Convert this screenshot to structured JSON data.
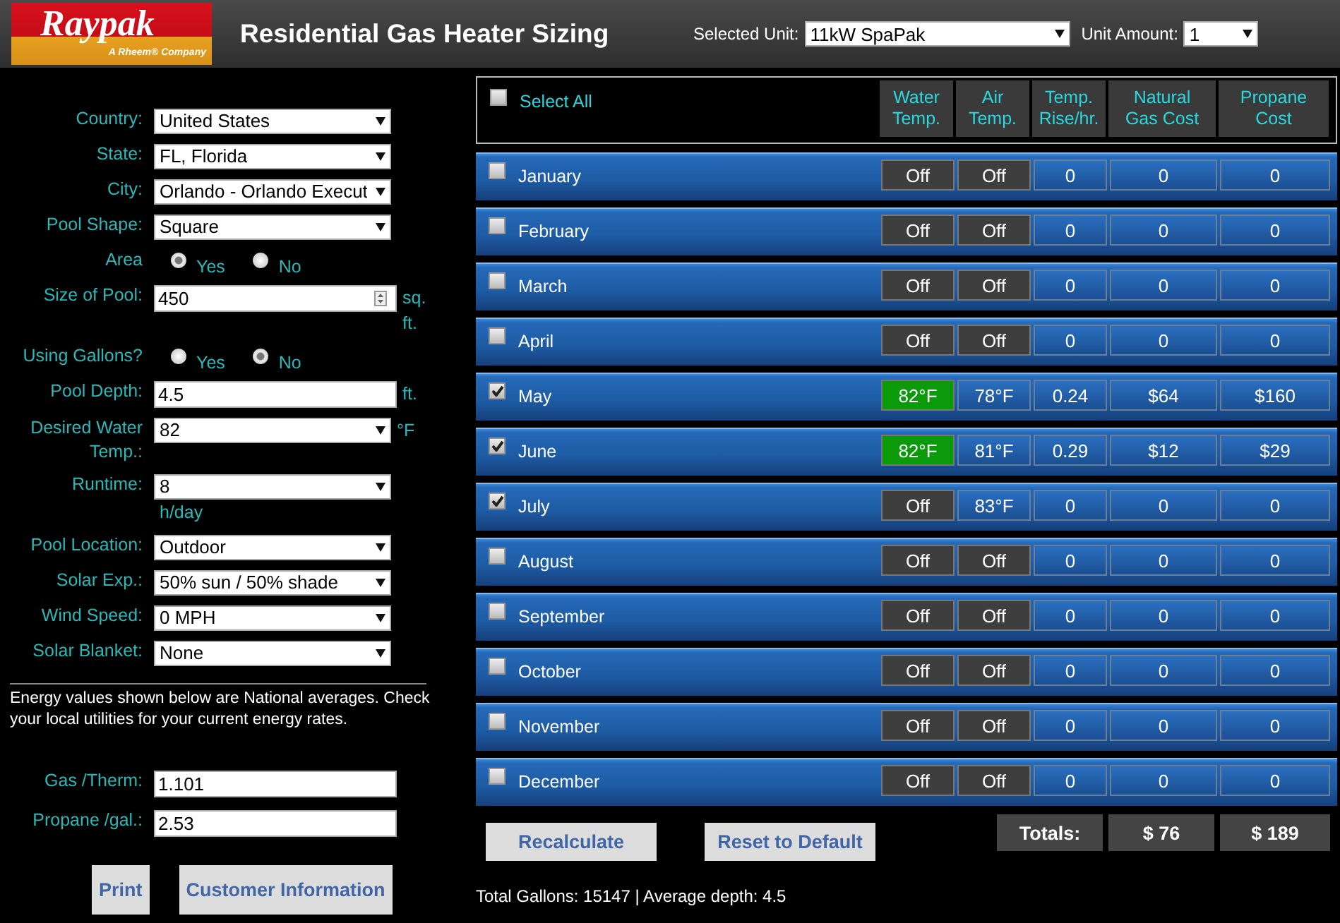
{
  "header": {
    "logo": {
      "wordmark": "Raypak",
      "tagline": "A Rheem® Company"
    },
    "title": "Residential Gas Heater Sizing",
    "unit_label": "Selected Unit:",
    "unit_value": "11kW SpaPak",
    "amount_label": "Unit Amount:",
    "amount_value": "1"
  },
  "form": [
    {
      "kind": "select",
      "label": "Country:",
      "value": "United States"
    },
    {
      "kind": "select",
      "label": "State:",
      "value": "FL, Florida"
    },
    {
      "kind": "select",
      "label": "City:",
      "value": "Orlando - Orlando Execut"
    },
    {
      "kind": "select",
      "label": "Pool Shape:",
      "value": "Square"
    },
    {
      "kind": "radio",
      "label": "Area",
      "options": [
        {
          "label": "Yes",
          "selected": true
        },
        {
          "label": "No",
          "selected": false
        }
      ]
    },
    {
      "kind": "number",
      "label": "Size of Pool:",
      "value": "450",
      "unit": "sq. ft."
    },
    {
      "kind": "radio",
      "label": "Using Gallons?",
      "options": [
        {
          "label": "Yes",
          "selected": false
        },
        {
          "label": "No",
          "selected": true
        }
      ]
    },
    {
      "kind": "input",
      "label": "Pool Depth:",
      "value": "4.5",
      "unit": "ft."
    },
    {
      "kind": "select",
      "label": "Desired Water Temp.:",
      "value": "82",
      "unit": "°F"
    },
    {
      "kind": "select",
      "label": "Runtime:",
      "value": "8",
      "unit": "h/day"
    },
    {
      "kind": "select",
      "label": "Pool Location:",
      "value": "Outdoor"
    },
    {
      "kind": "select",
      "label": "Solar Exp.:",
      "value": "50% sun / 50% shade"
    },
    {
      "kind": "select",
      "label": "Wind Speed:",
      "value": "0 MPH"
    },
    {
      "kind": "select",
      "label": "Solar Blanket:",
      "value": "None"
    }
  ],
  "note": "Energy values shown below are National averages. Check your local utilities for your current energy rates.",
  "rates": [
    {
      "label": "Gas /Therm:",
      "value": "1.101"
    },
    {
      "label": "Propane /gal.:",
      "value": "2.53"
    }
  ],
  "left_buttons": [
    "Print",
    "Customer Information"
  ],
  "table": {
    "select_all": {
      "label": "Select All",
      "checked": false
    },
    "columns": [
      "Water Temp.",
      "Air Temp.",
      "Temp. Rise/hr.",
      "Natural Gas Cost",
      "Propane Cost"
    ],
    "rows": [
      {
        "month": "January",
        "checked": false,
        "water": {
          "text": "Off",
          "on": false
        },
        "air": {
          "text": "Off",
          "on": false
        },
        "rise": "0",
        "gas": "0",
        "propane": "0"
      },
      {
        "month": "February",
        "checked": false,
        "water": {
          "text": "Off",
          "on": false
        },
        "air": {
          "text": "Off",
          "on": false
        },
        "rise": "0",
        "gas": "0",
        "propane": "0"
      },
      {
        "month": "March",
        "checked": false,
        "water": {
          "text": "Off",
          "on": false
        },
        "air": {
          "text": "Off",
          "on": false
        },
        "rise": "0",
        "gas": "0",
        "propane": "0"
      },
      {
        "month": "April",
        "checked": false,
        "water": {
          "text": "Off",
          "on": false
        },
        "air": {
          "text": "Off",
          "on": false
        },
        "rise": "0",
        "gas": "0",
        "propane": "0"
      },
      {
        "month": "May",
        "checked": true,
        "water": {
          "text": "82°F",
          "on": true
        },
        "air": {
          "text": "78°F",
          "on": true
        },
        "rise": "0.24",
        "gas": "$64",
        "propane": "$160"
      },
      {
        "month": "June",
        "checked": true,
        "water": {
          "text": "82°F",
          "on": true
        },
        "air": {
          "text": "81°F",
          "on": true
        },
        "rise": "0.29",
        "gas": "$12",
        "propane": "$29"
      },
      {
        "month": "July",
        "checked": true,
        "water": {
          "text": "Off",
          "on": false
        },
        "air": {
          "text": "83°F",
          "on": true
        },
        "rise": "0",
        "gas": "0",
        "propane": "0"
      },
      {
        "month": "August",
        "checked": false,
        "water": {
          "text": "Off",
          "on": false
        },
        "air": {
          "text": "Off",
          "on": false
        },
        "rise": "0",
        "gas": "0",
        "propane": "0"
      },
      {
        "month": "September",
        "checked": false,
        "water": {
          "text": "Off",
          "on": false
        },
        "air": {
          "text": "Off",
          "on": false
        },
        "rise": "0",
        "gas": "0",
        "propane": "0"
      },
      {
        "month": "October",
        "checked": false,
        "water": {
          "text": "Off",
          "on": false
        },
        "air": {
          "text": "Off",
          "on": false
        },
        "rise": "0",
        "gas": "0",
        "propane": "0"
      },
      {
        "month": "November",
        "checked": false,
        "water": {
          "text": "Off",
          "on": false
        },
        "air": {
          "text": "Off",
          "on": false
        },
        "rise": "0",
        "gas": "0",
        "propane": "0"
      },
      {
        "month": "December",
        "checked": false,
        "water": {
          "text": "Off",
          "on": false
        },
        "air": {
          "text": "Off",
          "on": false
        },
        "rise": "0",
        "gas": "0",
        "propane": "0"
      }
    ]
  },
  "buttons": [
    "Recalculate",
    "Reset to Default"
  ],
  "totals": {
    "label": "Totals:",
    "gas": "$ 76",
    "propane": "$ 189"
  },
  "summary": "Total Gallons: 15147 | Average depth: 4.5"
}
